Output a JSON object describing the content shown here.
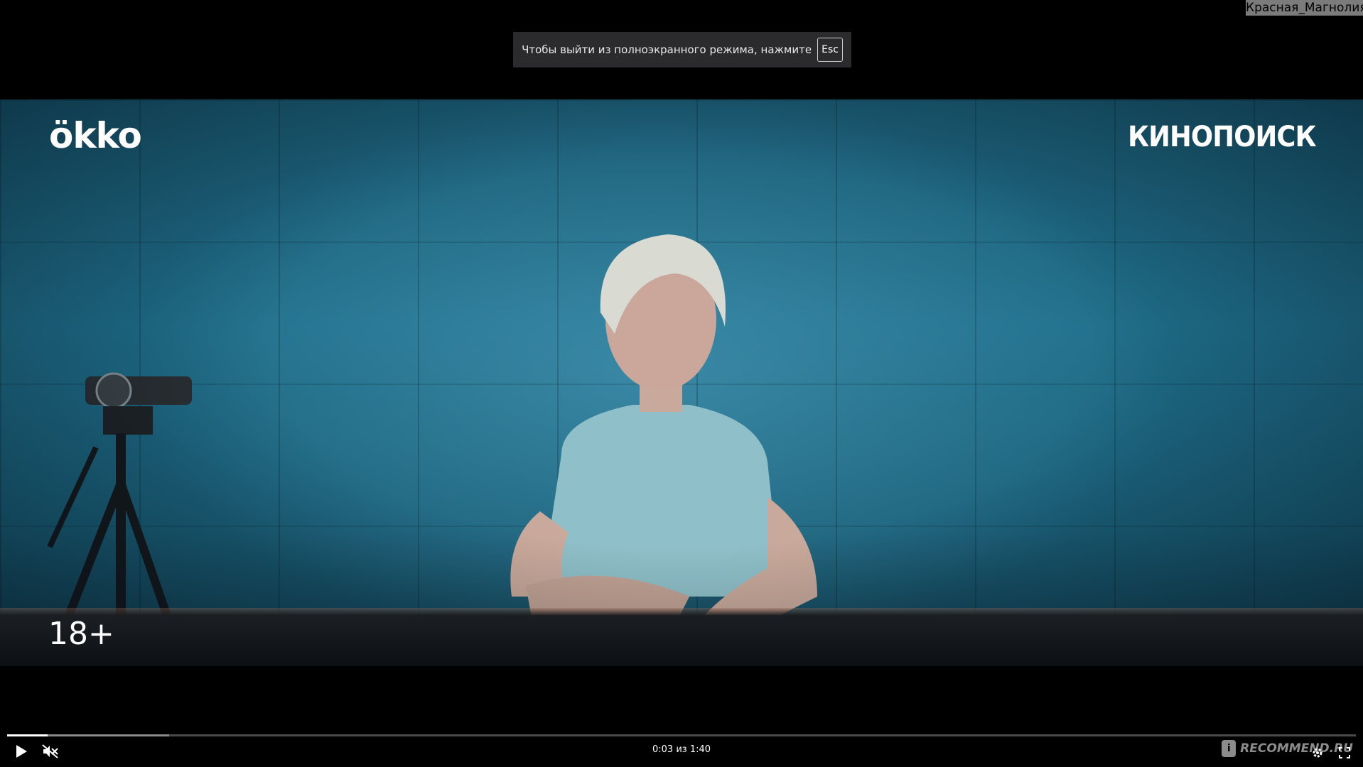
{
  "watermark_top_right": "Красная_Магнолия",
  "fullscreen_toast": {
    "message": "Чтобы выйти из полноэкранного режима, нажмите",
    "key": "Esc"
  },
  "video": {
    "logo_left": "ökko",
    "logo_right": "КИНОПОИСК",
    "age_rating": "18+"
  },
  "player": {
    "progress": 0.03,
    "buffered": 0.12,
    "current_time": "0:03",
    "separator": "из",
    "duration": "1:40"
  },
  "watermark_bottom_right": "RECOMMEND.RU",
  "watermark_badge": "i",
  "icons": {
    "play": "play-icon",
    "mute": "muted-speaker-icon",
    "settings": "gear-icon",
    "fullscreen": "fullscreen-icon"
  },
  "colors": {
    "background": "#000000",
    "wall": "#1f6e8a",
    "toast": "#2b2b2d",
    "progress_fill": "#ffffff"
  }
}
